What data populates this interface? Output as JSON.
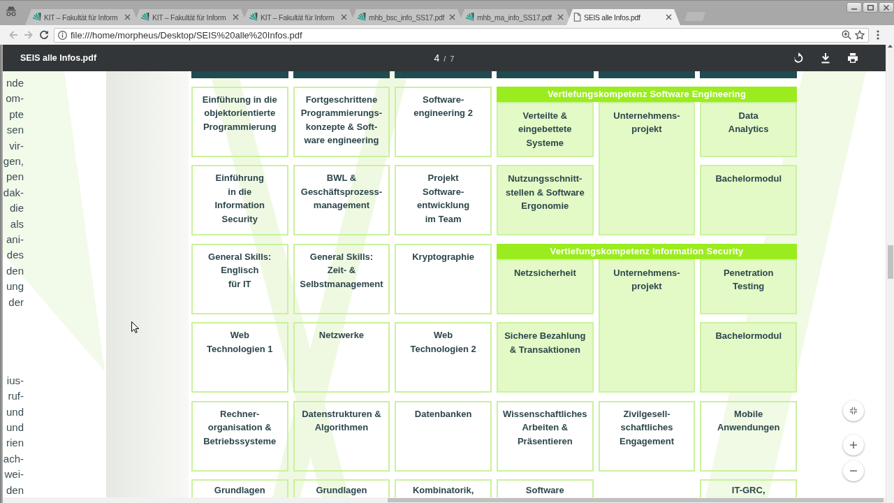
{
  "browser": {
    "tabs": [
      {
        "title": "KIT – Fakultät für Inform",
        "kind": "site",
        "selected": false
      },
      {
        "title": "KIT – Fakultät für Inform",
        "kind": "site",
        "selected": false
      },
      {
        "title": "KIT – Fakultät für Inform",
        "kind": "site",
        "selected": false
      },
      {
        "title": "mhb_bsc_info_SS17.pdf",
        "kind": "site",
        "selected": false
      },
      {
        "title": "mhb_ma_info_SS17.pdf",
        "kind": "site",
        "selected": false
      },
      {
        "title": "SEIS alle Infos.pdf",
        "kind": "document",
        "selected": true
      }
    ],
    "nav_buttons": [
      {
        "kind": "back",
        "disabled": true
      },
      {
        "kind": "forward",
        "disabled": true
      },
      {
        "kind": "reload",
        "disabled": false
      }
    ],
    "address_bar": {
      "value": "file:///home/morpheus/Desktop/SEIS%20alle%20Infos.pdf"
    }
  },
  "pdf_toolbar": {
    "title": "SEIS alle Infos.pdf",
    "page": {
      "current": "4",
      "separator": "/",
      "total": "7"
    }
  },
  "page": {
    "text_fragments": [
      [
        "nde",
        "om-",
        "pte",
        "sen",
        "vir-",
        "gen,",
        "pen",
        "dak-",
        "die",
        "als",
        "ani-",
        "des",
        "den",
        "ung",
        "der"
      ],
      [
        "ius-",
        "ruf-",
        "und",
        "und",
        "rien",
        "ach-",
        "wei-",
        "den"
      ]
    ],
    "table": {
      "rows": [
        {
          "cells": [
            {
              "kind": "module",
              "text": "Einführung in die\nobjektorientierte\nProgrammierung"
            },
            {
              "kind": "module",
              "text": "Fortgeschrittene\nProgrammierungs-\nkonzepte & Soft-\nware engineering"
            },
            {
              "kind": "module",
              "text": "Software-\nengineering 2"
            },
            {
              "kind": "section",
              "title": "Vertiefungskompetenz Software Engineering",
              "modules": [
                {
                  "kind": "module",
                  "text": "Verteilte &\neingebettete\nSysteme"
                },
                {
                  "kind": "tall",
                  "text": "Unternehmens-\nprojekt"
                },
                {
                  "kind": "module",
                  "text": "Data\nAnalytics"
                },
                {
                  "kind": "module",
                  "text": "Nutzungsschnitt-\nstellen & Software\nErgonomie"
                },
                {
                  "kind": "module",
                  "text": "Bachelormodul"
                }
              ]
            }
          ]
        },
        {
          "cells": [
            {
              "kind": "module",
              "text": "Einführung\nin die\nInformation\nSecurity"
            },
            {
              "kind": "module",
              "text": "BWL &\nGeschäftsprozess-\nmanagement"
            },
            {
              "kind": "module",
              "text": "Projekt\nSoftware-\nentwicklung\nim Team"
            }
          ]
        },
        {
          "cells": [
            {
              "kind": "module",
              "text": "General Skills:\nEnglisch\nfür IT"
            },
            {
              "kind": "module",
              "text": "General Skills:\nZeit- &\nSelbstmanagement"
            },
            {
              "kind": "module",
              "text": "Kryptographie"
            },
            {
              "kind": "section",
              "title": "Vertiefungskompetenz Information Security",
              "modules": [
                {
                  "kind": "module",
                  "text": "Netzsicherheit"
                },
                {
                  "kind": "tall",
                  "text": "Unternehmens-\nprojekt"
                },
                {
                  "kind": "module",
                  "text": "Penetration\nTesting"
                },
                {
                  "kind": "module",
                  "text": "Sichere Bezahlung\n& Transaktionen"
                },
                {
                  "kind": "module",
                  "text": "Bachelormodul"
                }
              ]
            }
          ]
        },
        {
          "cells": [
            {
              "kind": "module",
              "text": "Web\nTechnologien 1"
            },
            {
              "kind": "module",
              "text": "Netzwerke"
            },
            {
              "kind": "module",
              "text": "Web\nTechnologien 2"
            }
          ]
        },
        {
          "cells": [
            {
              "kind": "module",
              "text": "Rechner-\norganisation &\nBetriebssysteme"
            },
            {
              "kind": "module",
              "text": "Datenstrukturen &\nAlgorithmen"
            },
            {
              "kind": "module",
              "text": "Datenbanken"
            },
            {
              "kind": "module",
              "text": "Wissenschaftliches\nArbeiten &\nPräsentieren"
            },
            {
              "kind": "module",
              "text": "Zivilgesell-\nschaftliches\nEngagement"
            },
            {
              "kind": "module",
              "text": "Mobile\nAnwendungen"
            }
          ]
        },
        {
          "cells": [
            {
              "kind": "module",
              "text": "Grundlagen"
            },
            {
              "kind": "module",
              "text": "Grundlagen"
            },
            {
              "kind": "module",
              "text": "Kombinatorik,"
            },
            {
              "kind": "module",
              "text": "Software"
            },
            {
              "kind": "gap"
            },
            {
              "kind": "module",
              "text": "IT-GRC,"
            }
          ]
        }
      ]
    }
  }
}
